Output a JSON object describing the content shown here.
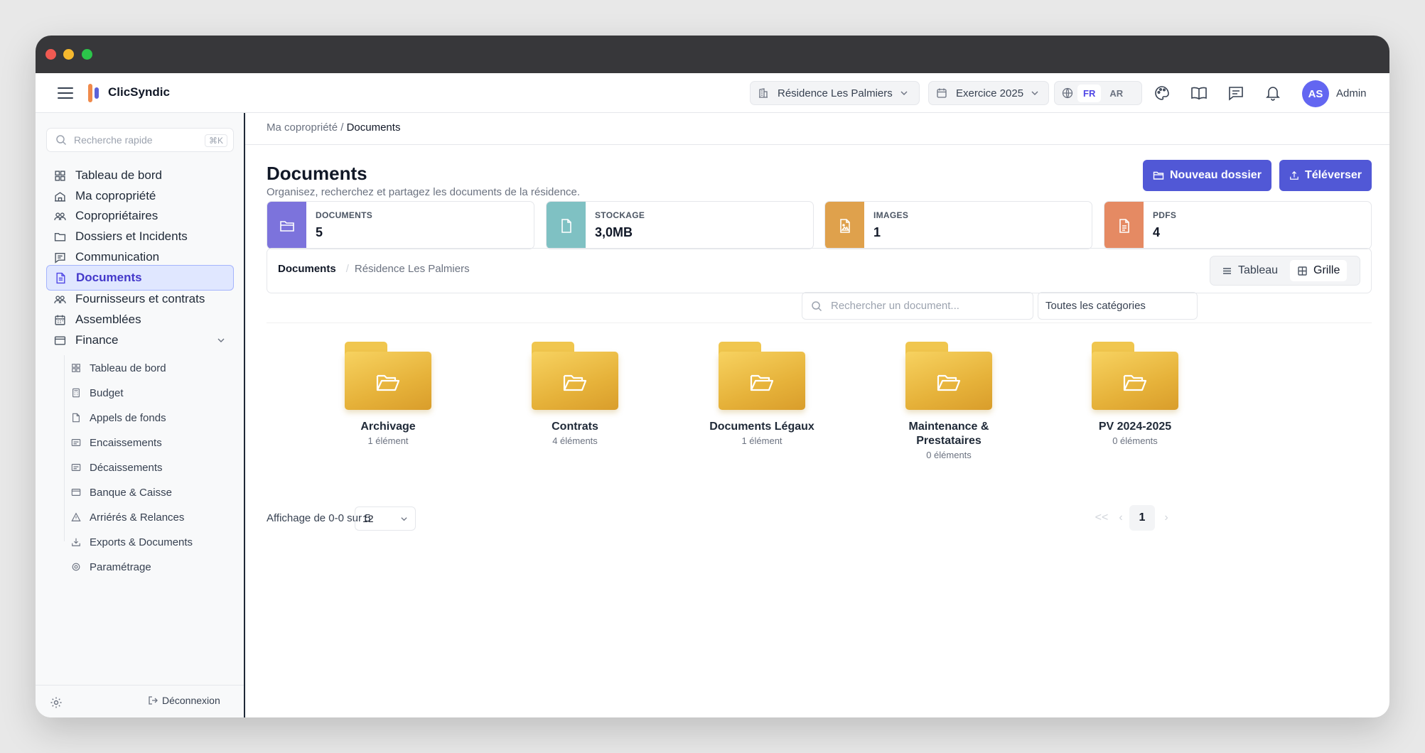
{
  "app": {
    "name": "ClicSyndic"
  },
  "topbar": {
    "residence": "Résidence Les Palmiers",
    "exercise": "Exercice 2025",
    "lang_fr": "FR",
    "lang_ar": "AR",
    "avatar_initials": "AS",
    "user_name": "Admin"
  },
  "sidebar": {
    "search_placeholder": "Recherche rapide",
    "search_shortcut": "⌘K",
    "items": [
      {
        "label": "Tableau de bord",
        "icon": "grid-icon"
      },
      {
        "label": "Ma copropriété",
        "icon": "building-icon"
      },
      {
        "label": "Copropriétaires",
        "icon": "users-icon"
      },
      {
        "label": "Dossiers et Incidents",
        "icon": "folder-icon"
      },
      {
        "label": "Communication",
        "icon": "message-icon"
      },
      {
        "label": "Documents",
        "icon": "file-icon",
        "active": true
      },
      {
        "label": "Fournisseurs et contrats",
        "icon": "users-icon"
      },
      {
        "label": "Assemblées",
        "icon": "calendar-icon"
      },
      {
        "label": "Finance",
        "icon": "wallet-icon",
        "expanded": true
      }
    ],
    "finance_items": [
      {
        "label": "Tableau de bord"
      },
      {
        "label": "Budget"
      },
      {
        "label": "Appels de fonds"
      },
      {
        "label": "Encaissements"
      },
      {
        "label": "Décaissements"
      },
      {
        "label": "Banque & Caisse"
      },
      {
        "label": "Arriérés & Relances"
      },
      {
        "label": "Exports & Documents"
      },
      {
        "label": "Paramétrage"
      }
    ],
    "logout": "Déconnexion"
  },
  "main": {
    "breadcrumb_parent": "Ma copropriété",
    "breadcrumb_sep": "/",
    "breadcrumb_current": "Documents",
    "title": "Documents",
    "subtitle": "Organisez, recherchez et partagez les documents de la résidence.",
    "btn_new_folder": "Nouveau dossier",
    "btn_upload": "Téléverser",
    "stats": [
      {
        "label": "DOCUMENTS",
        "value": "5",
        "color": "#7c73dc"
      },
      {
        "label": "STOCKAGE",
        "value": "3,0MB",
        "color": "#7fc1c3"
      },
      {
        "label": "IMAGES",
        "value": "1",
        "color": "#dfa14c"
      },
      {
        "label": "PDFS",
        "value": "4",
        "color": "#e58a63"
      }
    ],
    "path_root": "Documents",
    "path_sep": "/",
    "path_child": "Résidence Les Palmiers",
    "view_table": "Tableau",
    "view_grid": "Grille",
    "doc_search_placeholder": "Rechercher un document...",
    "category_select": "Toutes les catégories",
    "folders": [
      {
        "name": "Archivage",
        "count": "1 élément"
      },
      {
        "name": "Contrats",
        "count": "4 éléments"
      },
      {
        "name": "Documents Légaux",
        "count": "1 élément"
      },
      {
        "name": "Maintenance & Prestataires",
        "count": "0 éléments"
      },
      {
        "name": "PV 2024-2025",
        "count": "0 éléments"
      }
    ],
    "pagination_info": "Affichage de 0-0 sur 5",
    "per_page": "12",
    "page_first": "<<",
    "page_prev": "‹",
    "page_current": "1",
    "page_next": "›"
  }
}
